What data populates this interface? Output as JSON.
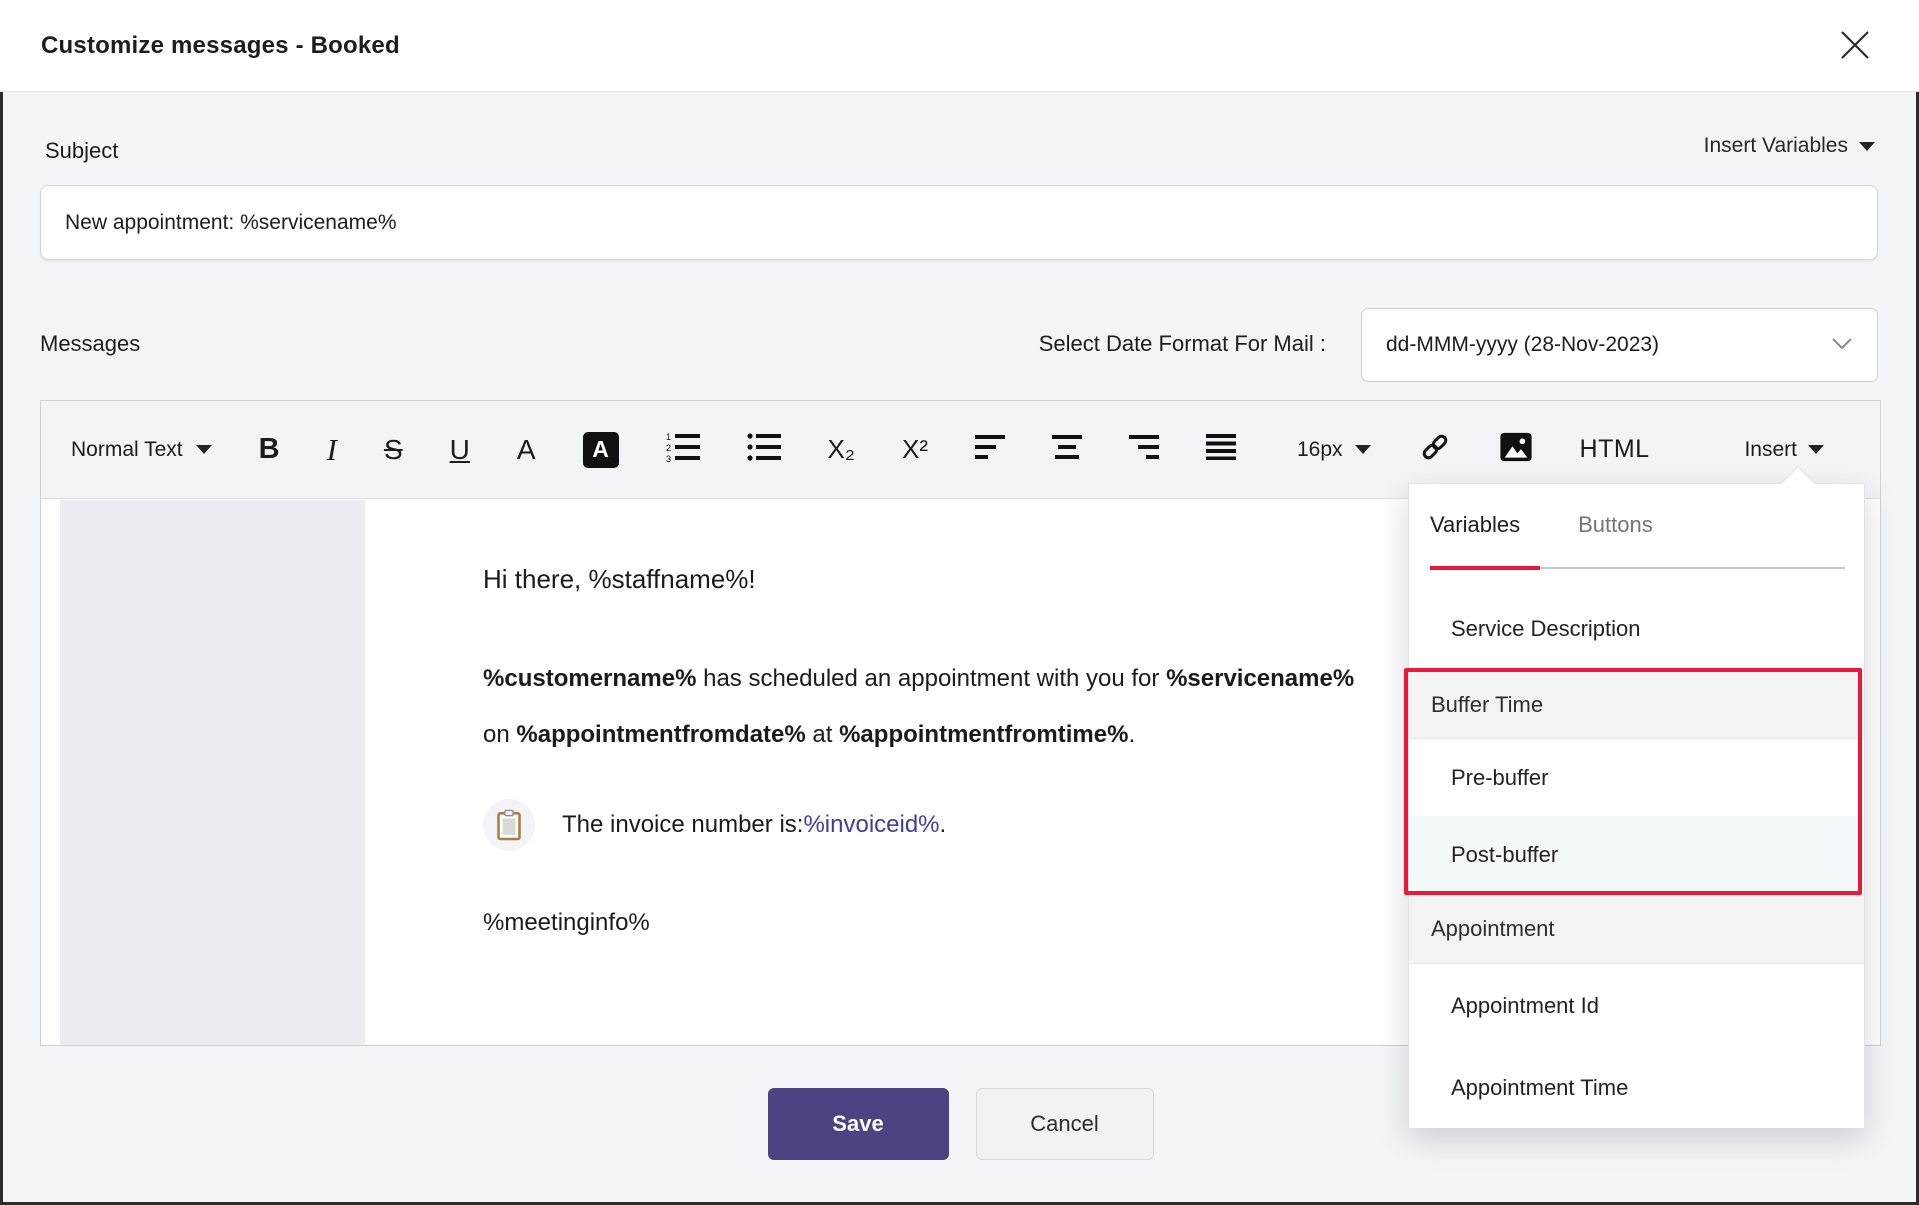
{
  "modal": {
    "title": "Customize messages - Booked"
  },
  "subject": {
    "label": "Subject",
    "value": "New appointment: %servicename%"
  },
  "insert_variables": {
    "label": "Insert Variables"
  },
  "messages": {
    "label": "Messages",
    "date_format_label": "Select Date Format For Mail :",
    "date_format_value": "dd-MMM-yyyy (28-Nov-2023)"
  },
  "toolbar": {
    "paragraph_style": "Normal Text",
    "bold": "B",
    "italic": "I",
    "strikethrough": "S",
    "underline": "U",
    "font_color": "A",
    "background_color": "A",
    "subscript": "X₂",
    "superscript": "X²",
    "font_size": "16px",
    "html": "HTML",
    "insert": "Insert"
  },
  "editor": {
    "greeting": "Hi there, %staffname%!",
    "paragraph": {
      "segments": [
        {
          "text": "%customername%",
          "bold": true
        },
        {
          "text": " has scheduled an appointment with you for ",
          "bold": false
        },
        {
          "text": "%servicename%",
          "bold": true
        },
        {
          "text": " on ",
          "bold": false
        },
        {
          "text": "%appointmentfromdate%",
          "bold": true
        },
        {
          "text": " at ",
          "bold": false
        },
        {
          "text": "%appointmentfromtime%",
          "bold": true
        },
        {
          "text": ".",
          "bold": false
        }
      ]
    },
    "invoice": {
      "prefix": "The invoice number is:",
      "variable": "%invoiceid%",
      "suffix": "."
    },
    "meeting_info": "%meetinginfo%"
  },
  "insert_menu": {
    "tabs": [
      {
        "label": "Variables",
        "active": true
      },
      {
        "label": "Buttons",
        "active": false
      }
    ],
    "items": [
      {
        "label": "Service Description",
        "type": "item"
      },
      {
        "label": "Buffer Time",
        "type": "header"
      },
      {
        "label": "Pre-buffer",
        "type": "item"
      },
      {
        "label": "Post-buffer",
        "type": "item"
      },
      {
        "label": "Appointment",
        "type": "header"
      },
      {
        "label": "Appointment Id",
        "type": "item"
      },
      {
        "label": "Appointment Time",
        "type": "item"
      }
    ]
  },
  "footer": {
    "save": "Save",
    "cancel": "Cancel"
  },
  "colors": {
    "accent_red": "#e8193c",
    "save_purple": "#4c4383",
    "invoice_variable": "#3e3e9d"
  }
}
